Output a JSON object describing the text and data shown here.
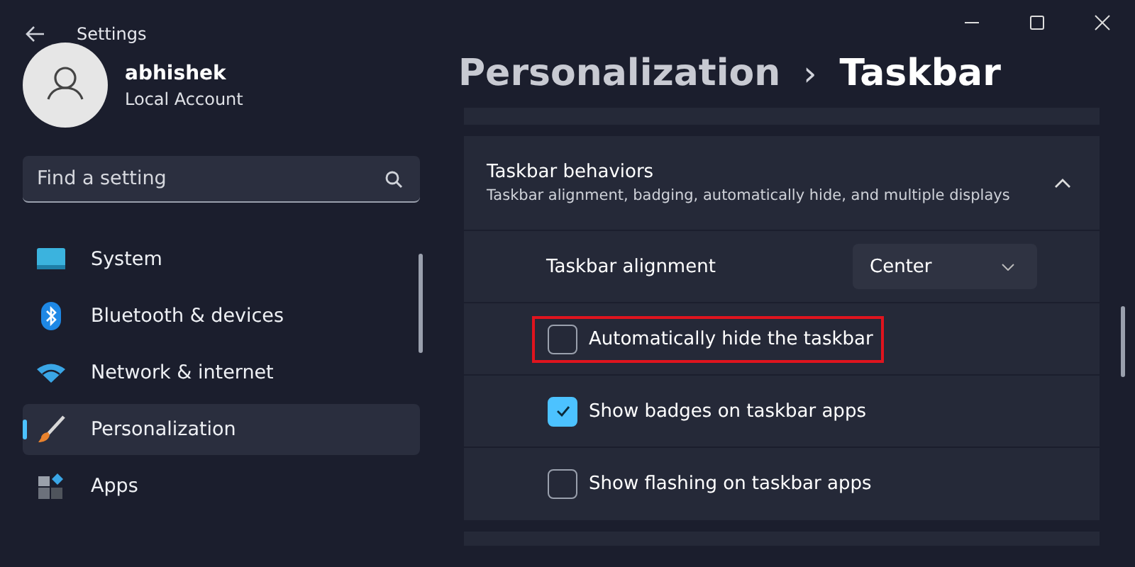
{
  "window": {
    "title": "Settings"
  },
  "account": {
    "name": "abhishek",
    "type": "Local Account"
  },
  "search": {
    "placeholder": "Find a setting"
  },
  "sidebar": {
    "items": [
      {
        "label": "System",
        "kind": "monitor",
        "selected": false
      },
      {
        "label": "Bluetooth & devices",
        "kind": "bluetooth",
        "selected": false
      },
      {
        "label": "Network & internet",
        "kind": "wifi",
        "selected": false
      },
      {
        "label": "Personalization",
        "kind": "brush",
        "selected": true
      },
      {
        "label": "Apps",
        "kind": "apps",
        "selected": false
      }
    ]
  },
  "breadcrumb": {
    "parent": "Personalization",
    "separator": "›",
    "current": "Taskbar"
  },
  "section": {
    "title": "Taskbar behaviors",
    "description": "Taskbar alignment, badging, automatically hide, and multiple displays",
    "expanded": true,
    "rows": [
      {
        "kind": "dropdown",
        "label": "Taskbar alignment",
        "value": "Center"
      },
      {
        "kind": "checkbox",
        "label": "Automatically hide the taskbar",
        "checked": false,
        "highlighted": true
      },
      {
        "kind": "checkbox",
        "label": "Show badges on taskbar apps",
        "checked": true,
        "highlighted": false
      },
      {
        "kind": "checkbox",
        "label": "Show flashing on taskbar apps",
        "checked": false,
        "highlighted": false
      }
    ]
  }
}
